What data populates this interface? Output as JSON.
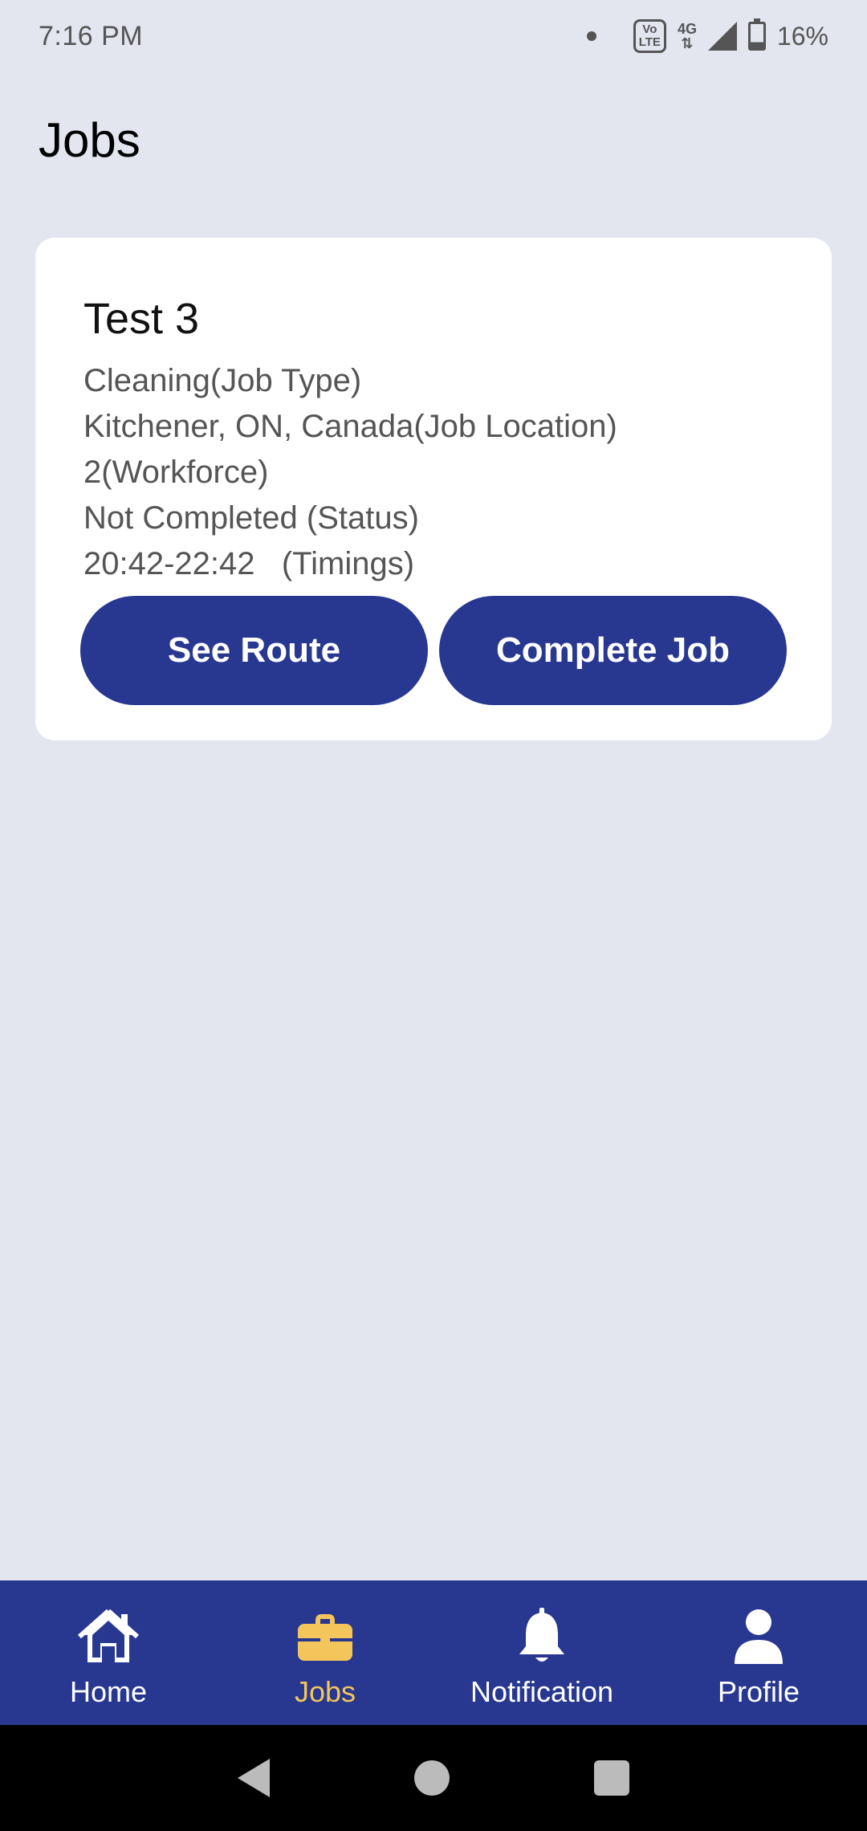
{
  "status_bar": {
    "time": "7:16 PM",
    "volte_label": "Vo\nLTE",
    "network": "4G",
    "battery": "16%"
  },
  "page": {
    "title": "Jobs"
  },
  "job": {
    "title": "Test 3",
    "type": "Cleaning(Job Type)",
    "location": "Kitchener, ON, Canada(Job Location)",
    "workforce": "2(Workforce)",
    "status": "Not Completed (Status)",
    "timings": "20:42-22:42   (Timings)",
    "see_route_label": "See Route",
    "complete_job_label": "Complete Job"
  },
  "bottom_nav": {
    "items": [
      {
        "label": "Home",
        "icon": "home-icon",
        "active": false
      },
      {
        "label": "Jobs",
        "icon": "briefcase-icon",
        "active": true
      },
      {
        "label": "Notification",
        "icon": "bell-icon",
        "active": false
      },
      {
        "label": "Profile",
        "icon": "person-icon",
        "active": false
      }
    ]
  },
  "colors": {
    "primary": "#283891",
    "accent": "#f4c55a",
    "background": "#e3e6ef",
    "card": "#ffffff"
  }
}
